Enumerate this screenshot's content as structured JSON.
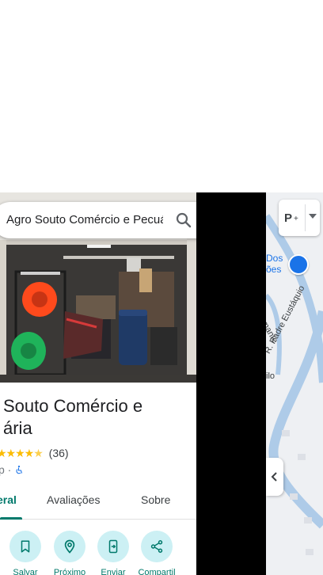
{
  "search": {
    "query": "Agro Souto Comércio e Pecuária"
  },
  "place": {
    "title": "Souto Comércio e\nária",
    "rating_count": "(36)",
    "category_tail": "p ·"
  },
  "tabs": [
    {
      "label": "eral"
    },
    {
      "label": "Avaliações"
    },
    {
      "label": "Sobre"
    }
  ],
  "actions": [
    {
      "label": "Salvar",
      "icon": "bookmark-icon"
    },
    {
      "label": "Próximo",
      "icon": "nearby-icon"
    },
    {
      "label": "Enviar",
      "icon": "send-to-phone-icon"
    },
    {
      "label": "Compartil",
      "icon": "share-icon"
    }
  ],
  "map": {
    "label_dos": "Dos",
    "label_oes": "ões",
    "street_main": "R. Padre Eustáquio",
    "street_mante": "mante",
    "street_ilo": "ilo",
    "layer_label": "P"
  },
  "colors": {
    "accent": "#00796b",
    "star": "#fbbc04",
    "map_road": "#aecbe8",
    "pin": "#1a73e8"
  }
}
